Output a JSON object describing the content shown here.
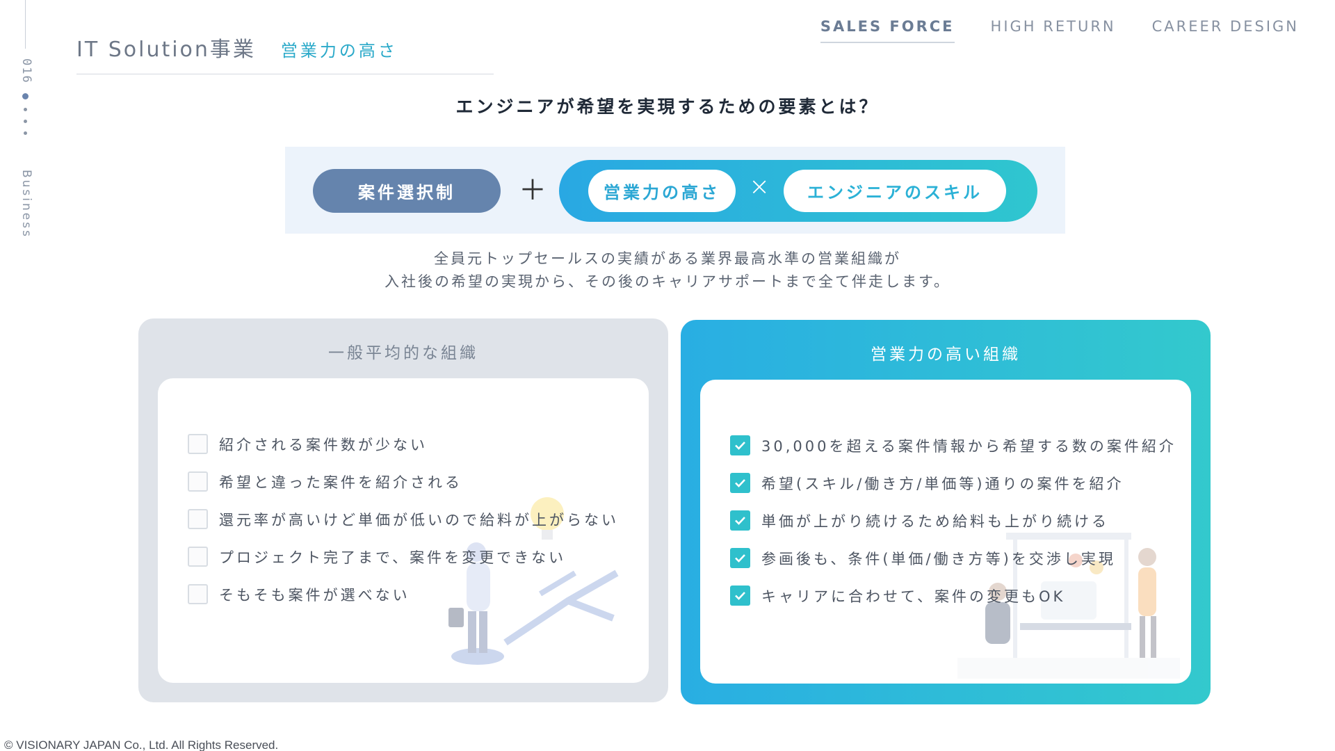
{
  "rail": {
    "page_number": "016",
    "section": "Business"
  },
  "header": {
    "title": "IT Solution事業",
    "subtitle": "営業力の高さ"
  },
  "nav": {
    "items": [
      "SALES FORCE",
      "HIGH RETURN",
      "CAREER DESIGN"
    ],
    "active": "SALES FORCE"
  },
  "question": "エンジニアが希望を実現するための要素とは？",
  "formula": {
    "selection": "案件選択制",
    "plus": "＋",
    "sales_power": "営業力の高さ",
    "times": "×",
    "engineer_skill": "エンジニアのスキル"
  },
  "description": {
    "line1": "全員元トップセールスの実績がある業界最高水準の営業組織が",
    "line2": "入社後の希望の実現から、その後のキャリアサポートまで全て伴走します。"
  },
  "left_card": {
    "title": "一般平均的な組織",
    "items": [
      "紹介される案件数が少ない",
      "希望と違った案件を紹介される",
      "還元率が高いけど単価が低いので給料が上がらない",
      "プロジェクト完了まで、案件を変更できない",
      "そもそも案件が選べない"
    ]
  },
  "right_card": {
    "title": "営業力の高い組織",
    "items": [
      "30,000を超える案件情報から希望する数の案件紹介",
      "希望(スキル/働き方/単価等)通りの案件を紹介",
      "単価が上がり続けるため給料も上がり続ける",
      "参画後も、条件(単価/働き方等)を交渉し実現",
      "キャリアに合わせて、案件の変更もOK"
    ]
  },
  "footer": "© VISIONARY JAPAN Co., Ltd. All Rights Reserved.",
  "colors": {
    "accent": "#2aa9c9",
    "select_pill": "#6584ad",
    "gradient_start": "#29aee3",
    "gradient_end": "#33c9cd"
  }
}
